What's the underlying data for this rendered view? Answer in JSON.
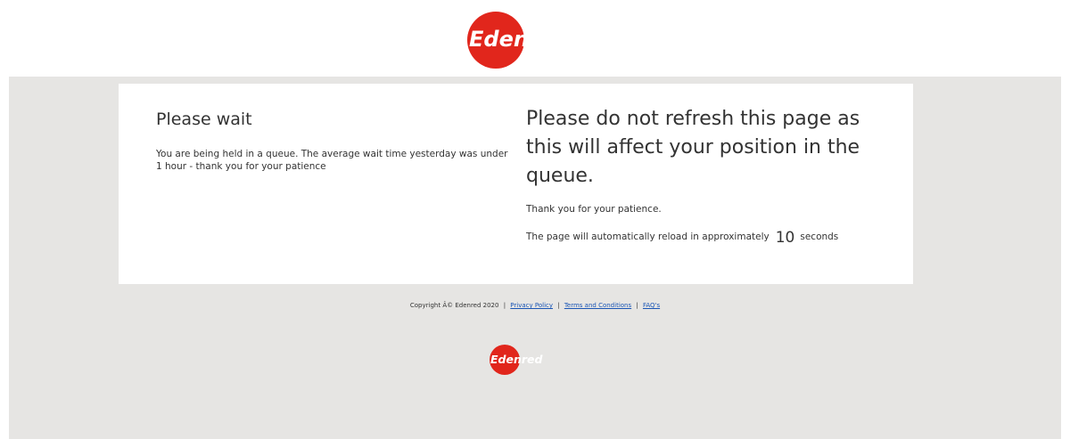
{
  "brand": {
    "name": "Edenred",
    "color": "#e1261c",
    "logo_icon": "edenred-logo-icon"
  },
  "left": {
    "title": "Please wait",
    "message": "You are being held in a queue. The average wait time yesterday was under 1 hour - thank you for your patience"
  },
  "right": {
    "title": "Please do not refresh this page as this will affect your position in the queue.",
    "thanks": "Thank you for your patience.",
    "reload_prefix": "The page will automatically reload in approximately",
    "countdown": "10",
    "reload_suffix": "seconds"
  },
  "footer": {
    "copyright": "Copyright Â© Edenred 2020",
    "separator": "|",
    "links": [
      "Privacy Policy",
      "Terms and Conditions",
      "FAQ's"
    ]
  }
}
